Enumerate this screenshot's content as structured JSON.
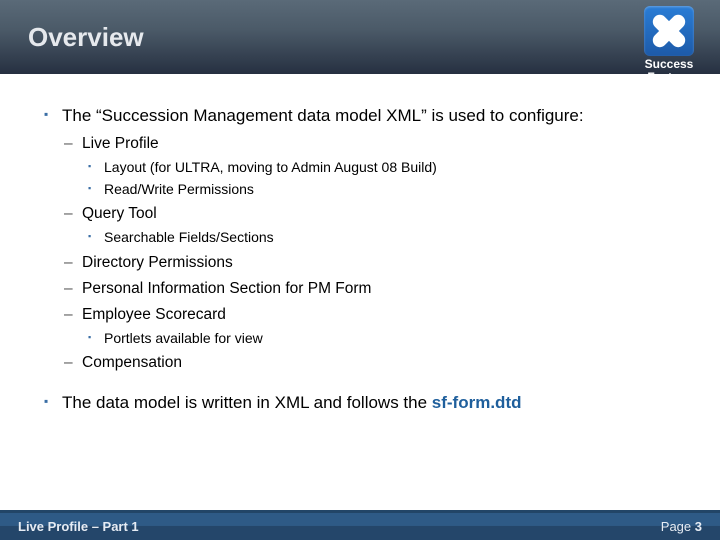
{
  "header": {
    "title": "Overview",
    "brand_line1": "Success",
    "brand_line2": "Factors"
  },
  "content": {
    "p1_intro": "The “Succession Management data model XML” is used to configure:",
    "p1_items": {
      "live_profile": {
        "label": "Live Profile",
        "sub": {
          "layout": "Layout (for ULTRA, moving to Admin August 08 Build)",
          "rw": "Read/Write Permissions"
        }
      },
      "query_tool": {
        "label": "Query Tool",
        "sub": {
          "searchable": "Searchable Fields/Sections"
        }
      },
      "directory_perm": "Directory Permissions",
      "personal_info": "Personal Information Section for PM Form",
      "employee_scorecard": {
        "label": "Employee Scorecard",
        "sub": {
          "portlets": "Portlets available for view"
        }
      },
      "compensation": "Compensation"
    },
    "p2_text": "The data model is written in XML and follows the ",
    "p2_em": "sf-form.dtd"
  },
  "footer": {
    "left": "Live Profile – Part 1",
    "page_label": "Page ",
    "page_number": "3"
  }
}
